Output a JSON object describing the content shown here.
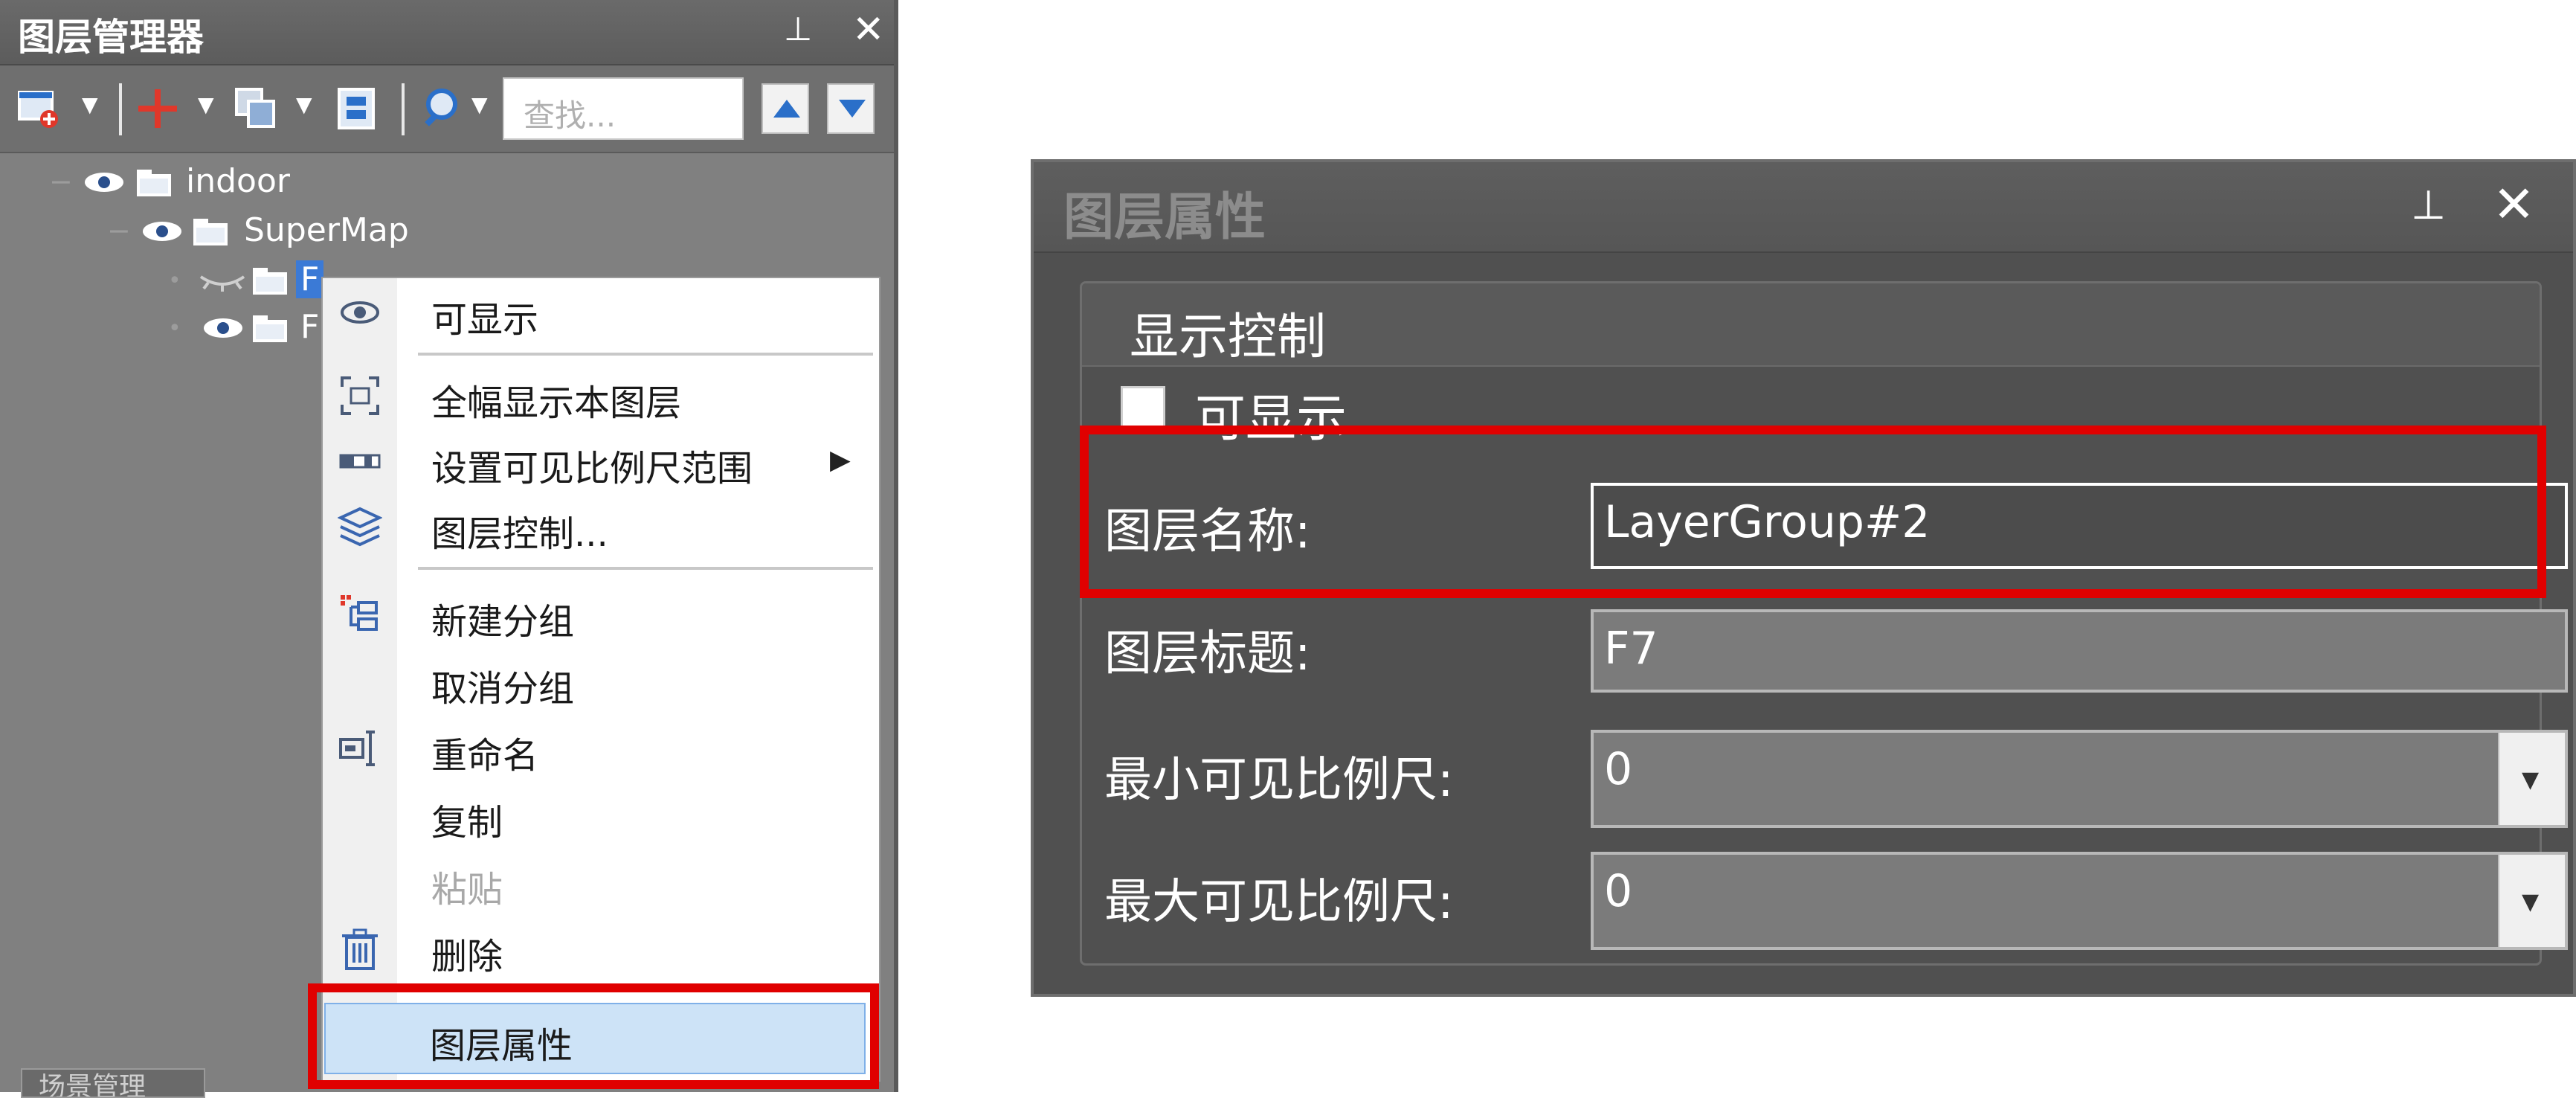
{
  "layer_manager": {
    "title": "图层管理器",
    "pin_glyph": "⊥",
    "close_glyph": "✕",
    "search_placeholder": "查找...",
    "tree": [
      {
        "label": "indoor",
        "visible": true,
        "expanded": true
      },
      {
        "label": "SuperMap",
        "visible": true,
        "expanded": true
      },
      {
        "label": "F",
        "visible": false,
        "selected": true
      },
      {
        "label": "F",
        "visible": true
      }
    ],
    "bottom_tab": "场景管理"
  },
  "context_menu": {
    "items": [
      {
        "label": "可显示",
        "icon": "eye-icon"
      },
      {
        "label": "全幅显示本图层",
        "icon": "fit-extent-icon"
      },
      {
        "label": "设置可见比例尺范围",
        "icon": "scale-bar-icon",
        "submenu": true
      },
      {
        "label": "图层控制...",
        "icon": "layers-icon"
      },
      {
        "label": "新建分组",
        "icon": "new-group-icon"
      },
      {
        "label": "取消分组",
        "icon": ""
      },
      {
        "label": "重命名",
        "icon": "rename-icon"
      },
      {
        "label": "复制",
        "icon": ""
      },
      {
        "label": "粘贴",
        "icon": "",
        "disabled": true
      },
      {
        "label": "删除",
        "icon": "trash-icon"
      },
      {
        "label": "图层属性",
        "icon": "",
        "highlighted": true
      }
    ]
  },
  "layer_props": {
    "title": "图层属性",
    "pin_glyph": "⊥",
    "close_glyph": "✕",
    "group_title": "显示控制",
    "visible_label": "可显示",
    "visible_checked": false,
    "name_label": "图层名称:",
    "name_value": "LayerGroup#2",
    "caption_label": "图层标题:",
    "caption_value": "F7",
    "min_scale_label": "最小可见比例尺:",
    "min_scale_value": "0",
    "max_scale_label": "最大可见比例尺:",
    "max_scale_value": "0"
  },
  "colors": {
    "highlight_frame": "#e00000",
    "selection": "#3b7ad6",
    "menu_highlight": "#cde3f7"
  }
}
